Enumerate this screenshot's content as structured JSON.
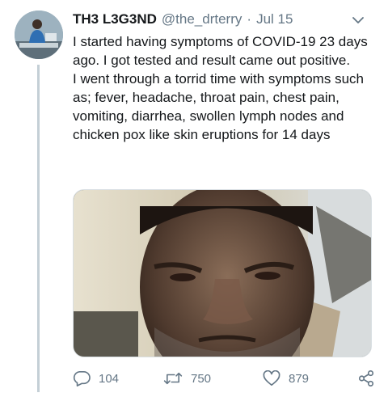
{
  "colors": {
    "secondary_text": "#657786",
    "primary_text": "#14171a",
    "thread_line": "#c4cfd6"
  },
  "tweet": {
    "display_name": "TH3 L3G3ND",
    "handle": "@the_drterry",
    "separator": "·",
    "date": "Jul 15",
    "text": "I started having symptoms of COVID-19 23 days ago.  I got tested and result came out positive.\nI went through a torrid time with symptoms such as; fever, headache, throat pain, chest pain, vomiting, diarrhea, swollen lymph nodes and  chicken pox like skin eruptions for 14 days"
  },
  "actions": {
    "reply": {
      "icon": "reply-icon",
      "count": "104"
    },
    "retweet": {
      "icon": "retweet-icon",
      "count": "750"
    },
    "like": {
      "icon": "heart-icon",
      "count": "879"
    },
    "share": {
      "icon": "share-icon"
    }
  },
  "header_menu_icon": "chevron-down-icon"
}
